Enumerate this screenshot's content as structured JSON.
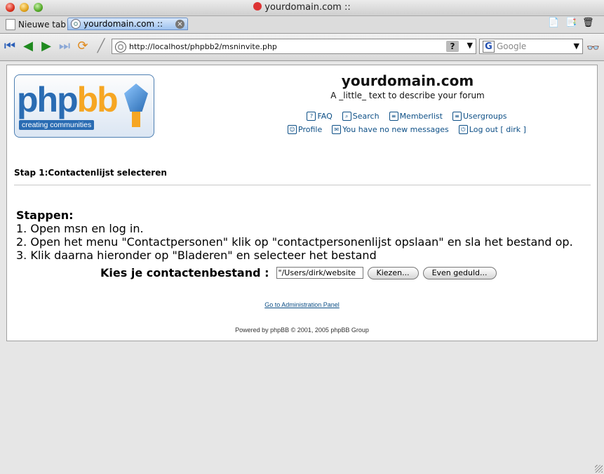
{
  "window": {
    "title": "yourdomain.com ::"
  },
  "tabs": [
    {
      "label": "Nieuwe tab"
    },
    {
      "label": "yourdomain.com ::"
    }
  ],
  "navigation": {
    "url": "http://localhost/phpbb2/msninvite.php",
    "search_placeholder": "Google"
  },
  "header": {
    "logo_text_a": "php",
    "logo_text_b": "bb",
    "logo_tagline": "creating communities",
    "site_title": "yourdomain.com",
    "site_description": "A _little_ text to describe your forum",
    "links_row1": [
      {
        "label": "FAQ",
        "icon": "faq-icon"
      },
      {
        "label": "Search",
        "icon": "search-icon"
      },
      {
        "label": "Memberlist",
        "icon": "memberlist-icon"
      },
      {
        "label": "Usergroups",
        "icon": "usergroups-icon"
      }
    ],
    "links_row2": [
      {
        "label": "Profile",
        "icon": "profile-icon"
      },
      {
        "label": "You have no new messages",
        "icon": "messages-icon"
      },
      {
        "label": "Log out [ dirk ]",
        "icon": "logout-icon"
      }
    ]
  },
  "main": {
    "step_title": "Stap 1:Contactenlijst selecteren",
    "steps_heading": "Stappen:",
    "steps": [
      "1. Open msn en log in.",
      "2. Open het menu \"Contactpersonen\" klik op \"contactpersonenlijst opslaan\" en sla het bestand op.",
      "3. Klik daarna hieronder op \"Bladeren\" en selecteer het bestand"
    ],
    "file_label": "Kies je contactenbestand :",
    "file_value": "\"/Users/dirk/website",
    "choose_button": "Kiezen...",
    "wait_button": "Even geduld..."
  },
  "footer": {
    "admin_link": "Go to Administration Panel",
    "powered_by": "Powered by phpBB © 2001, 2005 phpBB Group"
  }
}
